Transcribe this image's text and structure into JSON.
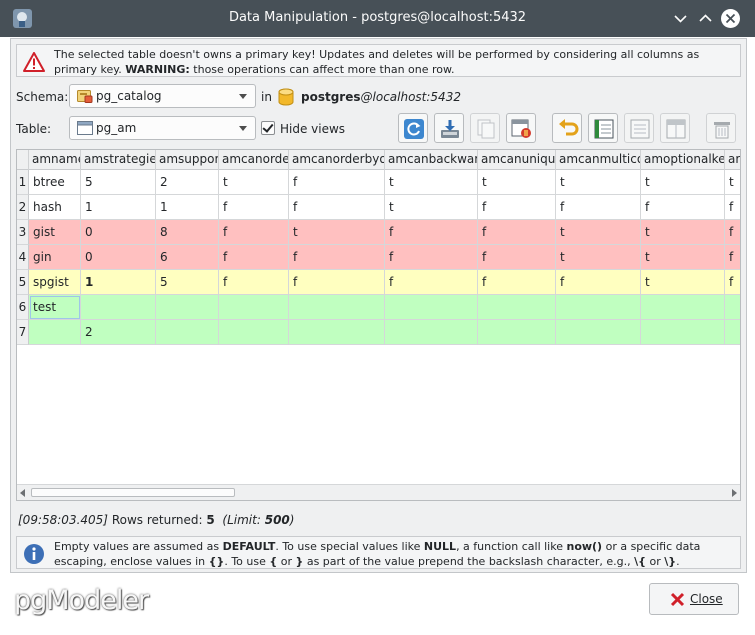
{
  "window": {
    "title": "Data Manipulation - postgres@localhost:5432"
  },
  "warning": {
    "text_before_bold": "The selected table doesn't owns a primary key! Updates and deletes will be performed by considering all columns as primary key.",
    "bold": "WARNING:",
    "text_after_bold": "those operations can affect more than one row."
  },
  "schema": {
    "label": "Schema:",
    "value": "pg_catalog",
    "in_label": "in",
    "connection_bold": "postgres",
    "connection_italic": "@localhost:5432"
  },
  "table": {
    "label": "Table:",
    "value": "pg_am",
    "hide_views_label": "Hide views",
    "hide_views_checked": true
  },
  "toolbar": {
    "icons": [
      "refresh-icon",
      "export-icon",
      "copy-icon",
      "browse-table-icon",
      "undo-icon",
      "save-icon",
      "columns-icon",
      "filter-icon",
      "delete-icon"
    ]
  },
  "grid": {
    "columns": [
      "amname",
      "amstrategies",
      "amsupport",
      "amcanorder",
      "amcanorderbyop",
      "amcanbackward",
      "amcanunique",
      "amcanmulticol",
      "amoptionalkey",
      "ar"
    ],
    "row_numbers": [
      "1",
      "2",
      "3",
      "4",
      "5",
      "6",
      "7"
    ],
    "rows": [
      [
        "btree",
        "5",
        "2",
        "t",
        "f",
        "t",
        "t",
        "t",
        "t",
        "t"
      ],
      [
        "hash",
        "1",
        "1",
        "f",
        "f",
        "t",
        "f",
        "f",
        "f",
        "f"
      ],
      [
        "gist",
        "0",
        "8",
        "f",
        "t",
        "f",
        "f",
        "t",
        "t",
        "f"
      ],
      [
        "gin",
        "0",
        "6",
        "f",
        "f",
        "f",
        "f",
        "t",
        "t",
        "f"
      ],
      [
        "spgist",
        "1",
        "5",
        "f",
        "f",
        "f",
        "f",
        "f",
        "t",
        "f"
      ],
      [
        "test",
        "",
        "",
        "",
        "",
        "",
        "",
        "",
        "",
        ""
      ],
      [
        "",
        "2",
        "",
        "",
        "",
        "",
        "",
        "",
        "",
        ""
      ]
    ],
    "row_states": [
      "normal",
      "normal",
      "deleted",
      "deleted",
      "modified",
      "inserted",
      "inserted"
    ],
    "colors": {
      "normal": "#ffffff",
      "deleted": "#ffc0c0",
      "modified": "#ffffc0",
      "inserted": "#c0ffc0"
    }
  },
  "status": {
    "time": "[09:58:03.405]",
    "rows_label": "Rows returned:",
    "rows_value": "5",
    "limit_label": "(Limit:",
    "limit_value": "500",
    "limit_close": ")"
  },
  "info": {
    "t1": "Empty values are assumed as",
    "b1": "DEFAULT",
    "t2": ". To use special values like",
    "b2": "NULL",
    "t3": ", a function call like",
    "b3": "now()",
    "t4": "or a specific data escaping, enclose values in",
    "b4": "{}",
    "t5": ". To use",
    "b5": "{",
    "t6": "or",
    "b6": "}",
    "t7": "as part of the value prepend the backslash character, e.g.,",
    "b7": "\\{",
    "t8": "or",
    "b8": "\\}",
    "t9": "."
  },
  "footer": {
    "logo": "pgModeler",
    "close_label": "Close"
  }
}
